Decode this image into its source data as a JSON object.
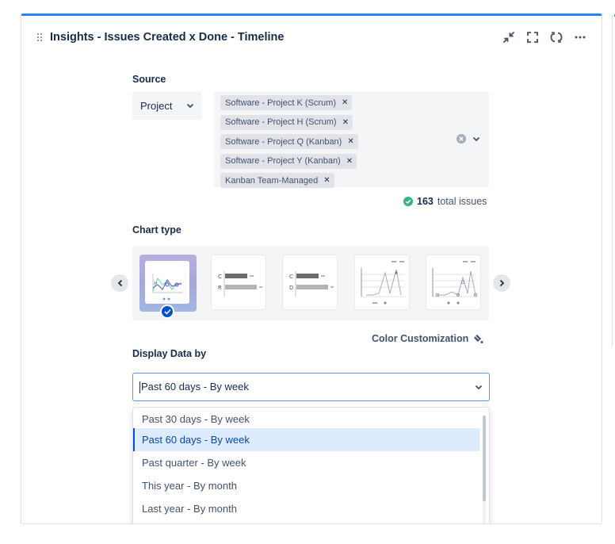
{
  "header": {
    "title": "Insights - Issues Created x Done - Timeline",
    "icons": [
      "minimize-icon",
      "fullscreen-icon",
      "refresh-icon",
      "more-icon"
    ]
  },
  "source": {
    "label": "Source",
    "type_value": "Project",
    "projects": [
      "Software - Project K (Scrum)",
      "Software - Project H (Scrum)",
      "Software - Project Q (Kanban)",
      "Software - Project Y (Kanban)",
      "Kanban Team-Managed"
    ],
    "total_count": "163",
    "total_label": "total issues"
  },
  "chart_type": {
    "label": "Chart type",
    "thumbs": {
      "bar1": {
        "a": "C",
        "b": "R"
      },
      "bar2": {
        "a": "C",
        "b": "D"
      }
    },
    "color_customization": "Color Customization"
  },
  "display": {
    "label": "Display Data by",
    "selected": "Past 60 days - By week",
    "options": [
      "Past 30 days - By week",
      "Past 60 days - By week",
      "Past quarter - By week",
      "This year - By month",
      "Last year - By month"
    ]
  },
  "colors": {
    "accent": "#2684ff",
    "selected_bg": "#deebff",
    "success": "#36b37e",
    "check": "#0052cc"
  }
}
